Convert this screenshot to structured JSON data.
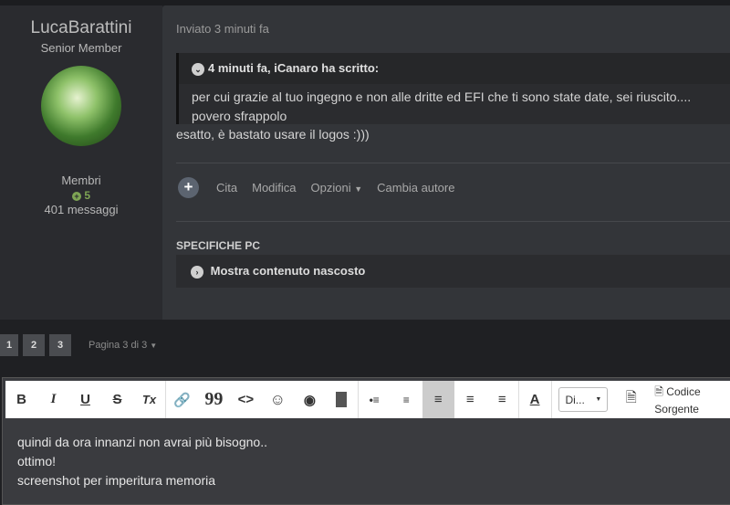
{
  "author": {
    "name": "LucaBarattini",
    "title": "Senior Member",
    "group": "Membri",
    "reputation": "5",
    "posts": "401 messaggi"
  },
  "post": {
    "meta": "Inviato 3 minuti fa",
    "quote": {
      "header_time": "4 minuti fa, ",
      "header_user": "iCanaro",
      "header_suffix": " ha scritto:",
      "lines": [
        "per cui grazie al tuo ingegno e non alle dritte ed EFI che ti sono state date, sei riuscito....",
        "povero sfrappolo"
      ]
    },
    "reply": "esatto,  è bastato usare il logos :)))",
    "actions": {
      "cita": "Cita",
      "modifica": "Modifica",
      "opzioni": "Opzioni",
      "cambia": "Cambia autore"
    },
    "spec_title": "SPECIFICHE PC",
    "hidden": "Mostra contenuto nascosto"
  },
  "pagination": {
    "pages": [
      "1",
      "2",
      "3"
    ],
    "info": "Pagina 3 di 3"
  },
  "editor": {
    "toolbar": {
      "bold": "B",
      "italic": "I",
      "underline": "U",
      "strike": "S",
      "clear": "Tx",
      "quote": "99",
      "code": "<>",
      "font_select": "Di...",
      "source": "Codice Sorgente"
    },
    "lines": [
      "quindi da ora innanzi non avrai più bisogno..",
      "ottimo!",
      "screenshot per imperitura memoria"
    ]
  }
}
